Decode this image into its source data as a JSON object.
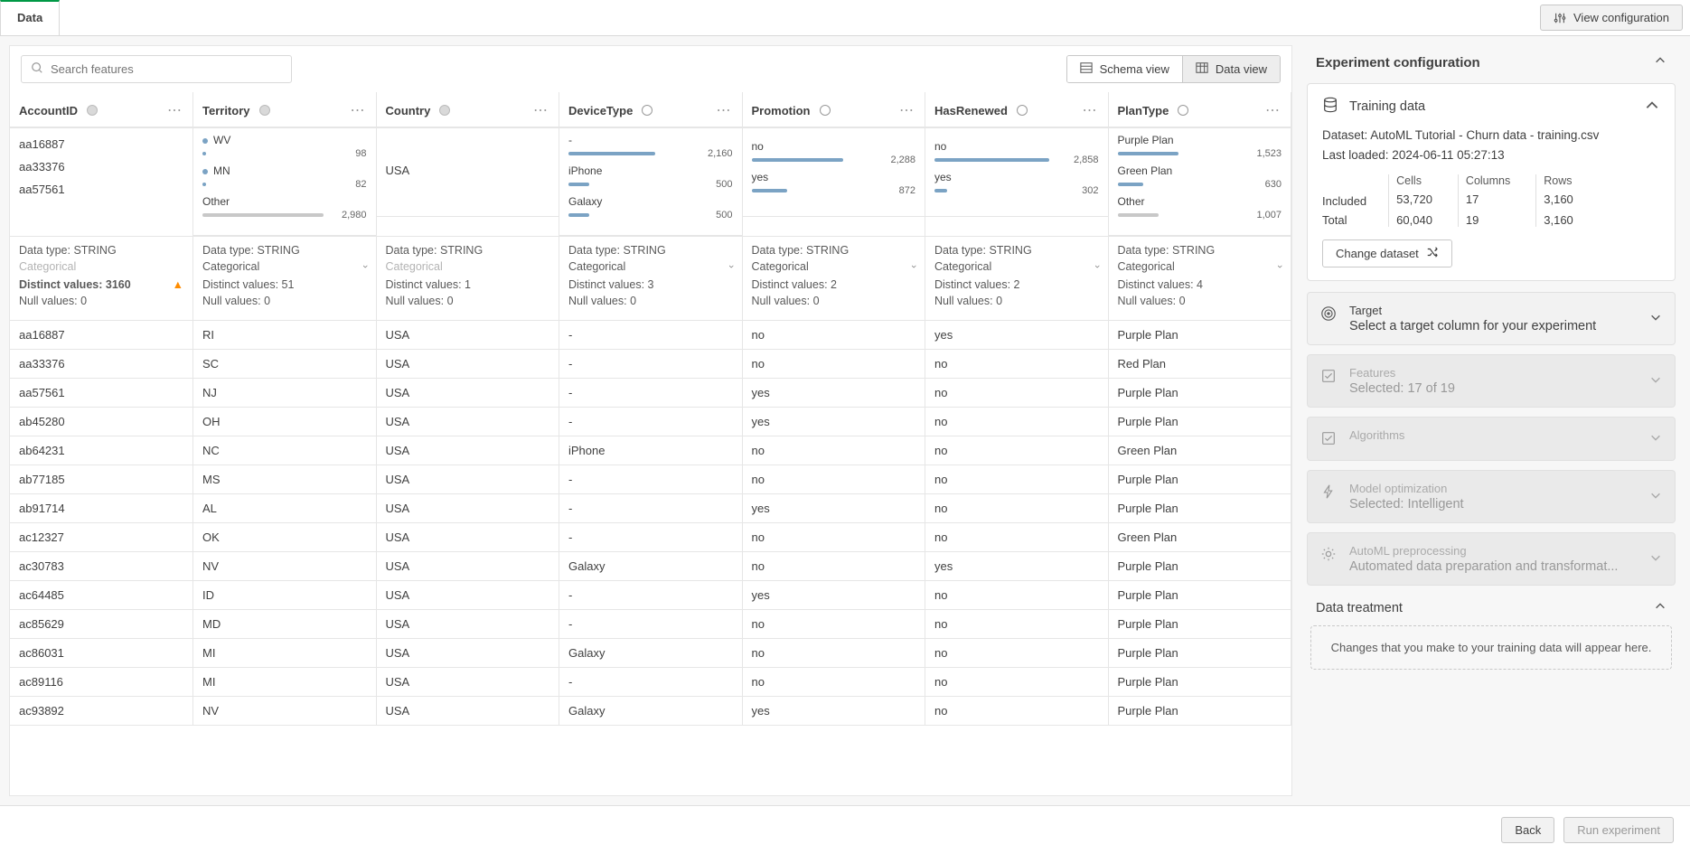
{
  "topbar": {
    "tab_label": "Data",
    "view_config_label": "View configuration"
  },
  "toolbar": {
    "search_placeholder": "Search features",
    "schema_view_label": "Schema view",
    "data_view_label": "Data view"
  },
  "columns": [
    {
      "name": "AccountID",
      "shape": "filled",
      "id_values": [
        "aa16887",
        "aa33376",
        "aa57561"
      ],
      "data_type": "Data type: STRING",
      "feature_type": "Categorical",
      "feature_type_disabled": true,
      "distinct": "Distinct values: 3160",
      "distinct_warn": true,
      "nulls": "Null values: 0"
    },
    {
      "name": "Territory",
      "shape": "filled",
      "freq": [
        {
          "label": "WV",
          "value": "98",
          "pct": 3,
          "grey": false,
          "dot": true
        },
        {
          "label": "MN",
          "value": "82",
          "pct": 3,
          "grey": false,
          "dot": true
        },
        {
          "label": "Other",
          "value": "2,980",
          "pct": 95,
          "grey": true
        }
      ],
      "data_type": "Data type: STRING",
      "feature_type": "Categorical",
      "feature_type_disabled": false,
      "distinct": "Distinct values: 51",
      "nulls": "Null values: 0"
    },
    {
      "name": "Country",
      "shape": "filled",
      "single_value": "USA",
      "data_type": "Data type: STRING",
      "feature_type": "Categorical",
      "feature_type_disabled": true,
      "distinct": "Distinct values: 1",
      "nulls": "Null values: 0"
    },
    {
      "name": "DeviceType",
      "shape": "open",
      "freq": [
        {
          "label": "-",
          "value": "2,160",
          "pct": 68,
          "grey": false
        },
        {
          "label": "iPhone",
          "value": "500",
          "pct": 16,
          "grey": false
        },
        {
          "label": "Galaxy",
          "value": "500",
          "pct": 16,
          "grey": false
        }
      ],
      "data_type": "Data type: STRING",
      "feature_type": "Categorical",
      "feature_type_disabled": false,
      "distinct": "Distinct values: 3",
      "nulls": "Null values: 0"
    },
    {
      "name": "Promotion",
      "shape": "open",
      "freq": [
        {
          "label": "no",
          "value": "2,288",
          "pct": 72,
          "grey": false
        },
        {
          "label": "yes",
          "value": "872",
          "pct": 28,
          "grey": false
        }
      ],
      "data_type": "Data type: STRING",
      "feature_type": "Categorical",
      "feature_type_disabled": false,
      "distinct": "Distinct values: 2",
      "nulls": "Null values: 0"
    },
    {
      "name": "HasRenewed",
      "shape": "open",
      "freq": [
        {
          "label": "no",
          "value": "2,858",
          "pct": 90,
          "grey": false
        },
        {
          "label": "yes",
          "value": "302",
          "pct": 10,
          "grey": false
        }
      ],
      "data_type": "Data type: STRING",
      "feature_type": "Categorical",
      "feature_type_disabled": false,
      "distinct": "Distinct values: 2",
      "nulls": "Null values: 0"
    },
    {
      "name": "PlanType",
      "shape": "open",
      "freq": [
        {
          "label": "Purple Plan",
          "value": "1,523",
          "pct": 48,
          "grey": false
        },
        {
          "label": "Green Plan",
          "value": "630",
          "pct": 20,
          "grey": false
        },
        {
          "label": "Other",
          "value": "1,007",
          "pct": 32,
          "grey": true
        }
      ],
      "data_type": "Data type: STRING",
      "feature_type": "Categorical",
      "feature_type_disabled": false,
      "distinct": "Distinct values: 4",
      "nulls": "Null values: 0"
    }
  ],
  "rows": [
    [
      "aa16887",
      "RI",
      "USA",
      "-",
      "no",
      "yes",
      "Purple Plan"
    ],
    [
      "aa33376",
      "SC",
      "USA",
      "-",
      "no",
      "no",
      "Red Plan"
    ],
    [
      "aa57561",
      "NJ",
      "USA",
      "-",
      "yes",
      "no",
      "Purple Plan"
    ],
    [
      "ab45280",
      "OH",
      "USA",
      "-",
      "yes",
      "no",
      "Purple Plan"
    ],
    [
      "ab64231",
      "NC",
      "USA",
      "iPhone",
      "no",
      "no",
      "Green Plan"
    ],
    [
      "ab77185",
      "MS",
      "USA",
      "-",
      "no",
      "no",
      "Purple Plan"
    ],
    [
      "ab91714",
      "AL",
      "USA",
      "-",
      "yes",
      "no",
      "Purple Plan"
    ],
    [
      "ac12327",
      "OK",
      "USA",
      "-",
      "no",
      "no",
      "Green Plan"
    ],
    [
      "ac30783",
      "NV",
      "USA",
      "Galaxy",
      "no",
      "yes",
      "Purple Plan"
    ],
    [
      "ac64485",
      "ID",
      "USA",
      "-",
      "yes",
      "no",
      "Purple Plan"
    ],
    [
      "ac85629",
      "MD",
      "USA",
      "-",
      "no",
      "no",
      "Purple Plan"
    ],
    [
      "ac86031",
      "MI",
      "USA",
      "Galaxy",
      "no",
      "no",
      "Purple Plan"
    ],
    [
      "ac89116",
      "MI",
      "USA",
      "-",
      "no",
      "no",
      "Purple Plan"
    ],
    [
      "ac93892",
      "NV",
      "USA",
      "Galaxy",
      "yes",
      "no",
      "Purple Plan"
    ]
  ],
  "sidebar": {
    "title": "Experiment configuration",
    "training_data": {
      "title": "Training data",
      "dataset_line": "Dataset: AutoML Tutorial - Churn data - training.csv",
      "loaded_line": "Last loaded: 2024-06-11 05:27:13",
      "stats": {
        "row_labels": [
          "Included",
          "Total"
        ],
        "cells_h": "Cells",
        "cells": [
          "53,720",
          "60,040"
        ],
        "columns_h": "Columns",
        "columns": [
          "17",
          "19"
        ],
        "rows_h": "Rows",
        "rows": [
          "3,160",
          "3,160"
        ]
      },
      "change_btn": "Change dataset"
    },
    "target": {
      "h": "Target",
      "s": "Select a target column for your experiment"
    },
    "features": {
      "h": "Features",
      "s": "Selected: 17 of 19"
    },
    "algorithms": {
      "h": "Algorithms"
    },
    "modelopt": {
      "h": "Model optimization",
      "s": "Selected: Intelligent"
    },
    "preproc": {
      "h": "AutoML preprocessing",
      "s": "Automated data preparation and transformat..."
    },
    "data_treatment_title": "Data treatment",
    "data_treatment_msg": "Changes that you make to your training data will appear here."
  },
  "footer": {
    "back": "Back",
    "run": "Run experiment"
  }
}
